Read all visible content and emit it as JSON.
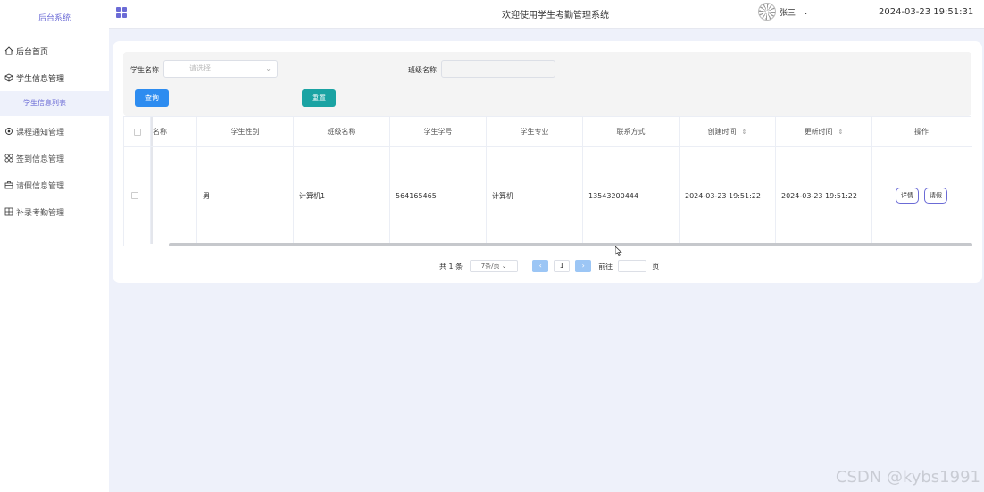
{
  "sidebar": {
    "brand": "后台系统",
    "items": [
      {
        "label": "后台首页",
        "icon": "home-icon"
      },
      {
        "label": "学生信息管理",
        "icon": "cube-icon"
      },
      {
        "label": "学生信息列表",
        "icon": ""
      },
      {
        "label": "课程通知管理",
        "icon": "gear-icon"
      },
      {
        "label": "签到信息管理",
        "icon": "apps-icon"
      },
      {
        "label": "请假信息管理",
        "icon": "briefcase-icon"
      },
      {
        "label": "补录考勤管理",
        "icon": "grid-icon"
      }
    ]
  },
  "header": {
    "title": "欢迎使用学生考勤管理系统",
    "user": "张三",
    "datetime": "2024-03-23 19:51:31"
  },
  "search": {
    "student_label": "学生名称",
    "student_placeholder": "请选择",
    "class_label": "班级名称",
    "query_button": "查询",
    "reset_button": "重置"
  },
  "table": {
    "columns": [
      "名称",
      "学生性别",
      "班级名称",
      "学生学号",
      "学生专业",
      "联系方式",
      "创建时间",
      "更新时间",
      "操作"
    ],
    "rows": [
      {
        "gender": "男",
        "class": "计算机1",
        "student_no": "564165465",
        "major": "计算机",
        "phone": "13543200444",
        "created": "2024-03-23 19:51:22",
        "updated": "2024-03-23 19:51:22",
        "detail_btn": "详情",
        "leave_btn": "请假"
      }
    ]
  },
  "pagination": {
    "total": "共 1 条",
    "page_size": "7条/页",
    "current_page": "1",
    "goto_label": "前往",
    "page_suffix": "页",
    "prev": "‹",
    "next": "›"
  },
  "watermark": "CSDN @kybs1991",
  "colors": {
    "accent": "#6b6bd6",
    "primary": "#2d8cf0",
    "teal": "#1aa3a3"
  }
}
